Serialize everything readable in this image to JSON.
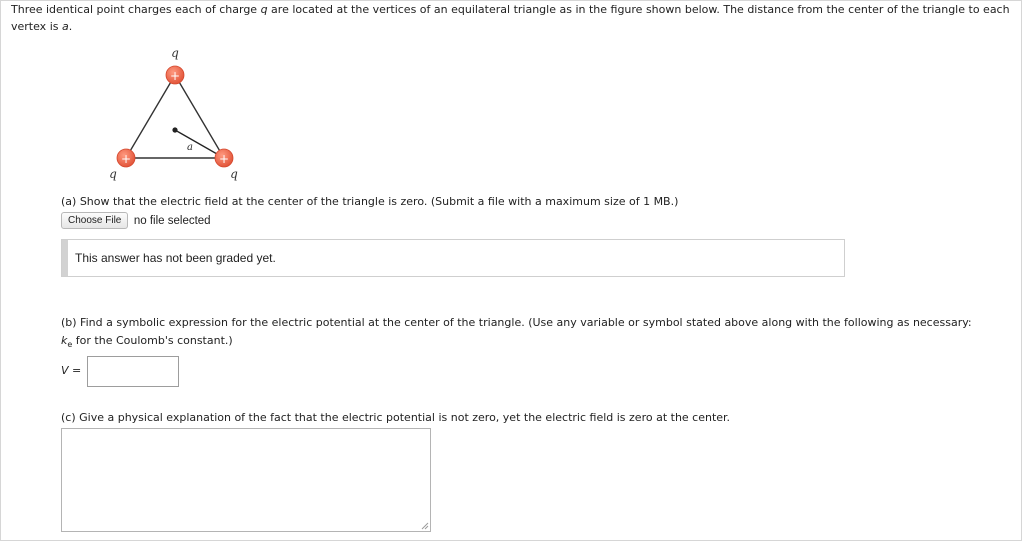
{
  "intro": {
    "text_before_q": "Three identical point charges each of charge ",
    "var_q": "q",
    "text_after_q": " are located at the vertices of an equilateral triangle as in the figure shown below. The distance from the center of the triangle to each vertex is ",
    "var_a": "a",
    "text_end": "."
  },
  "figure": {
    "charge_label_top": "q",
    "charge_label_left": "q",
    "charge_label_right": "q",
    "charge_sign": "+",
    "distance_label": "a",
    "charge_color": "#f06b4e",
    "triangle_color": "#333333"
  },
  "part_a": {
    "text": "(a) Show that the electric field at the center of the triangle is zero. (Submit a file with a maximum size of 1 MB.)",
    "file_button": "Choose File",
    "file_status": "no file selected",
    "grading_status": "This answer has not been graded yet."
  },
  "part_b": {
    "text_before": "(b) Find a symbolic expression for the electric potential at the center of the triangle. (Use any variable or symbol stated above along with the following as necessary: ",
    "ke_k": "k",
    "ke_sub": "e",
    "text_after": " for the Coulomb's constant.)",
    "v_var": "V",
    "v_eq": " =",
    "v_value": ""
  },
  "part_c": {
    "text": "(c) Give a physical explanation of the fact that the electric potential is not zero, yet the electric field is zero at the center.",
    "answer_value": ""
  }
}
